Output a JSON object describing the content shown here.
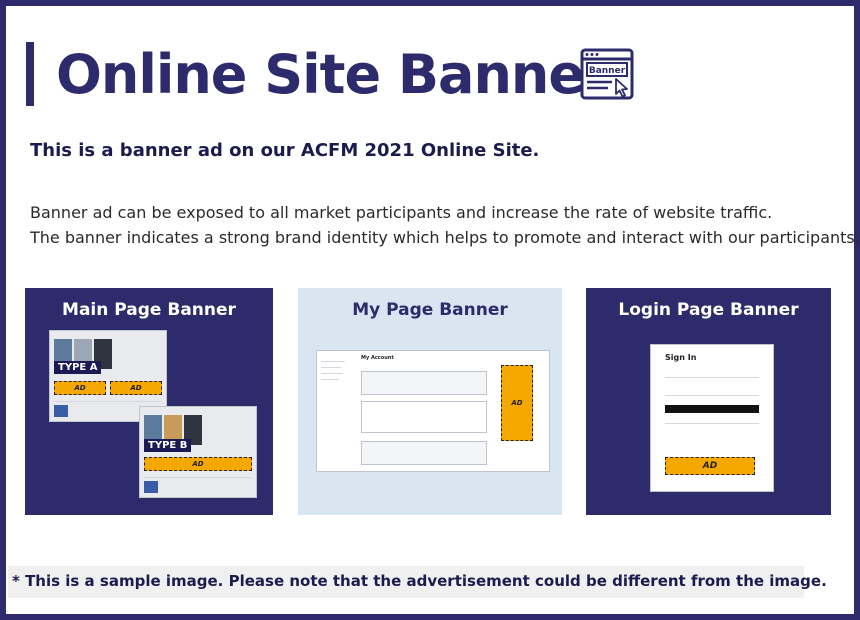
{
  "header": {
    "title": "Online Site Banner",
    "icon_label": "Banner"
  },
  "subtitle": "This is a banner ad on our ACFM 2021 Online Site.",
  "description": [
    "Banner ad can be exposed to all market participants and increase the rate of website traffic.",
    "The banner indicates a strong brand identity which helps to promote and interact with our participants."
  ],
  "panels": {
    "main": {
      "title": "Main Page Banner",
      "type_a": "TYPE A",
      "type_b": "TYPE B",
      "ad": "AD"
    },
    "my": {
      "title": "My Page Banner",
      "account_heading": "My Account",
      "ad": "AD"
    },
    "login": {
      "title": "Login Page Banner",
      "sign_in": "Sign In",
      "ad": "AD"
    }
  },
  "note": "* This is a sample image. Please note that the advertisement could be different from the image.",
  "colors": {
    "navy": "#2d2b6b",
    "ad_orange": "#f5a800",
    "light_blue": "#d9e6f1"
  }
}
